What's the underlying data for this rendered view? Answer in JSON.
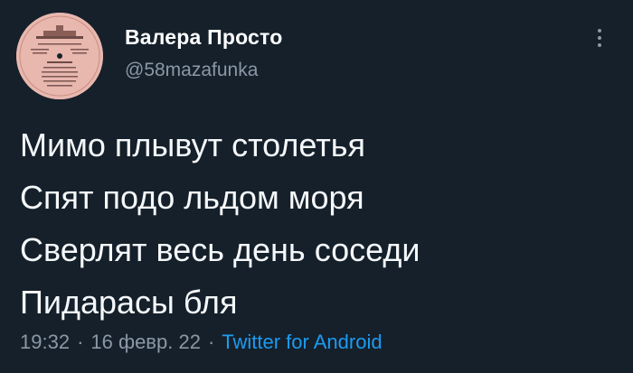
{
  "user": {
    "display_name": "Валера Просто",
    "handle": "@58mazafunka",
    "avatar_icon": "vinyl-record-label-avatar"
  },
  "tweet": {
    "lines": [
      "Мимо плывут столетья",
      "Спят подо льдом моря",
      "Сверлят весь день соседи",
      "Пидарасы бля"
    ]
  },
  "meta": {
    "time": "19:32",
    "date": "16 февр. 22",
    "separator": "·",
    "source": "Twitter for Android"
  },
  "colors": {
    "background": "#15202b",
    "secondary_text": "#8b98a5",
    "accent": "#1d9bf0",
    "avatar": "#e8b7ae"
  }
}
